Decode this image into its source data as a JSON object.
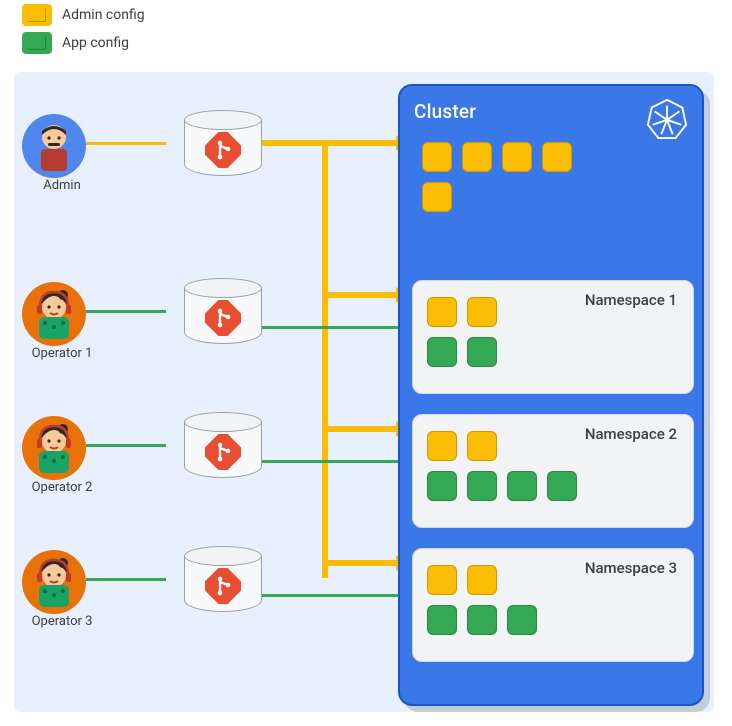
{
  "legend": {
    "item1": "Admin config",
    "item2": "App config"
  },
  "actors": {
    "admin": {
      "label": "Admin"
    },
    "op1": {
      "label": "Operator 1"
    },
    "op2": {
      "label": "Operator 2"
    },
    "op3": {
      "label": "Operator 3"
    }
  },
  "cluster": {
    "title": "Cluster",
    "namespaces": {
      "ns1": "Namespace 1",
      "ns2": "Namespace 2",
      "ns3": "Namespace 3"
    }
  },
  "colors": {
    "admin_config": "#fbbc04",
    "app_config": "#34a853",
    "cluster_bg": "#3b78e7",
    "git": "#e84e31"
  },
  "chart_data": {
    "type": "diagram",
    "description": "Config Sync multi-repo: one admin repo applies cluster-scoped config; each operator repo applies namespace-scoped app config; admin config also propagates into every namespace.",
    "actors": [
      {
        "role": "Admin",
        "repo": "admin-repo",
        "scope": "cluster"
      },
      {
        "role": "Operator 1",
        "repo": "operator-repo-1",
        "scope": "namespace-1"
      },
      {
        "role": "Operator 2",
        "repo": "operator-repo-2",
        "scope": "namespace-2"
      },
      {
        "role": "Operator 3",
        "repo": "operator-repo-3",
        "scope": "namespace-3"
      }
    ],
    "cluster_level_admin_objects": 5,
    "namespaces": [
      {
        "name": "Namespace 1",
        "admin_objects": 2,
        "app_objects": 2
      },
      {
        "name": "Namespace 2",
        "admin_objects": 2,
        "app_objects": 4
      },
      {
        "name": "Namespace 3",
        "admin_objects": 2,
        "app_objects": 3
      }
    ]
  }
}
